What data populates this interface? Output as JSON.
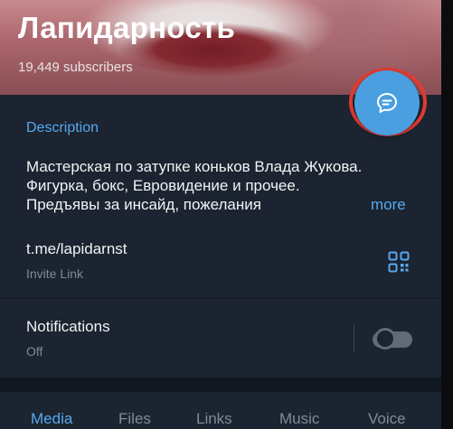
{
  "header": {
    "title": "Лапидарность",
    "subscribers": "19,449 subscribers"
  },
  "description": {
    "label": "Description",
    "text": "Мастерская по затупке коньков Влада Жукова. Фигурка, бокс, Евровидение и прочее.  Предъявы за инсайд, пожелания",
    "more": "more"
  },
  "invite": {
    "link": "t.me/lapidarnst",
    "caption": "Invite Link"
  },
  "notifications": {
    "label": "Notifications",
    "state": "Off",
    "enabled": false
  },
  "tabs": [
    {
      "label": "Media",
      "active": true
    },
    {
      "label": "Files",
      "active": false
    },
    {
      "label": "Links",
      "active": false
    },
    {
      "label": "Music",
      "active": false
    },
    {
      "label": "Voice",
      "active": false
    }
  ],
  "icons": {
    "fab": "message-bubble-icon",
    "qr": "qr-code-icon"
  },
  "colors": {
    "accent": "#57a9f0",
    "fab": "#4a9fe0",
    "highlight_ring": "#e23b33",
    "background": "#1b2430"
  }
}
